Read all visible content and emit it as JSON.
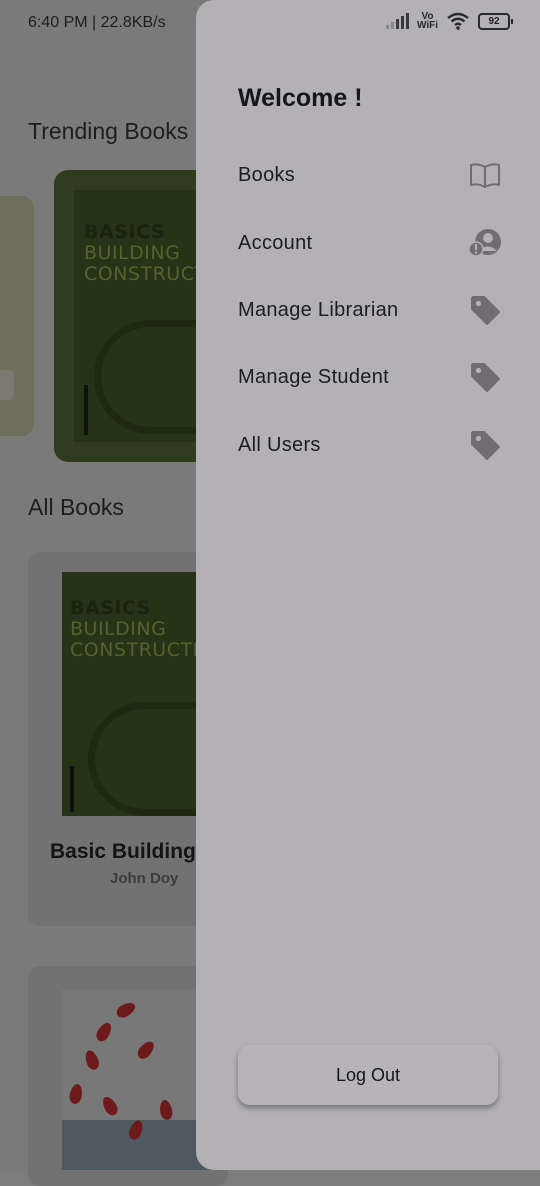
{
  "status_bar": {
    "time_speed": "6:40 PM | 22.8KB/s",
    "vowifi_line1": "Vo",
    "vowifi_line2": "WiFi",
    "battery": "92"
  },
  "background": {
    "trending_title": "Trending Books",
    "all_books_title": "All Books",
    "cover_line1": "BASICS",
    "cover_line2": "BUILDING",
    "cover_line3": "CONSTRUCTIO",
    "book_title": "Basic Building",
    "book_author": "John Doy"
  },
  "drawer": {
    "welcome": "Welcome !",
    "items": [
      {
        "label": "Books",
        "icon": "book-icon"
      },
      {
        "label": "Account",
        "icon": "account-icon"
      },
      {
        "label": "Manage Librarian",
        "icon": "tag-icon"
      },
      {
        "label": "Manage Student",
        "icon": "tag-icon"
      },
      {
        "label": "All Users",
        "icon": "tag-icon"
      }
    ],
    "logout": "Log Out"
  },
  "colors": {
    "drawer_bg": "#b3b1b6",
    "scrim": "#7a7a7a",
    "icon": "#6f6d72"
  }
}
